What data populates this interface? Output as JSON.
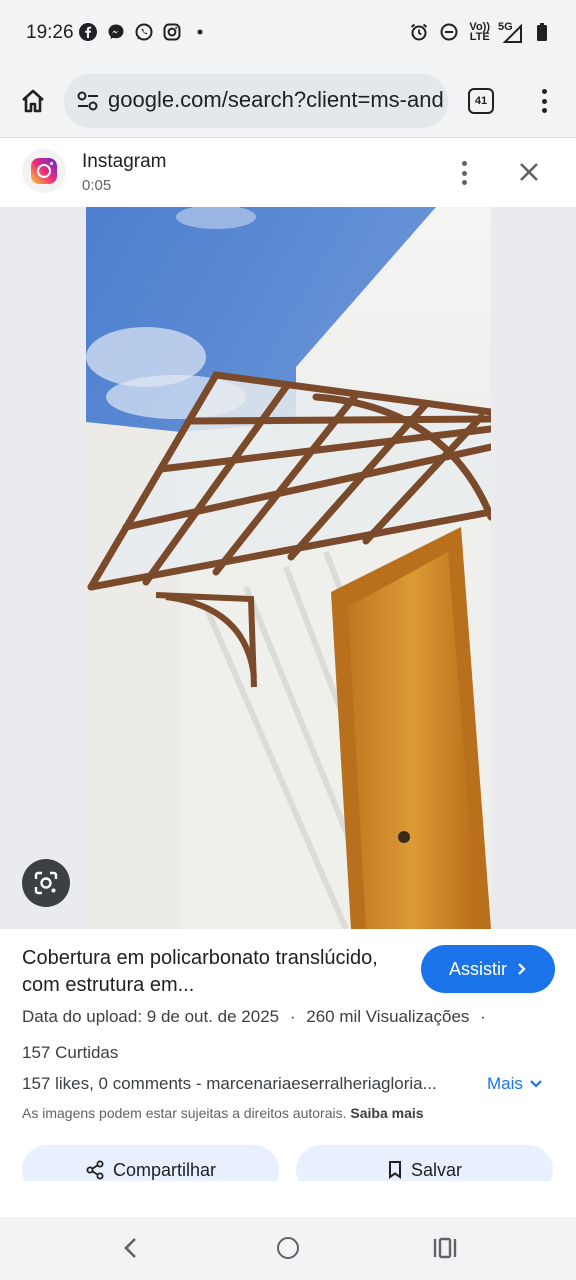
{
  "status_bar": {
    "time": "19:26",
    "left_icons": [
      "facebook-icon",
      "messenger-icon",
      "whatsapp-icon",
      "instagram-icon",
      "dot-icon"
    ],
    "right_icons": [
      "alarm-icon",
      "dnd-icon",
      "volte-icon",
      "signal-icon",
      "battery-icon"
    ],
    "network_top": "Vo))",
    "network_bottom": "LTE",
    "network_type": "5G"
  },
  "browser": {
    "url": "google.com/search?client=ms-and",
    "tab_count": "41"
  },
  "source": {
    "name": "Instagram",
    "time": "0:05"
  },
  "result": {
    "title": "Cobertura em policarbonato translúcido, com estrutura em...",
    "visit_label": "Assistir",
    "upload_date": "Data do upload: 9 de out. de 2025",
    "separator": "·",
    "views": "260 mil Visualizações",
    "likes_line": "157 Curtidas",
    "description": "157 likes, 0 comments - marcenariaeserralheriagloria...",
    "more_label": "Mais",
    "copyright_text": "As imagens podem estar sujeitas a direitos autorais.",
    "learn_more": "Saiba mais",
    "share_label": "Compartilhar",
    "save_label": "Salvar"
  },
  "colors": {
    "accent": "#1a73e8",
    "chrome_bg": "#f1f3f4",
    "button_tint": "#e8f0fe"
  }
}
